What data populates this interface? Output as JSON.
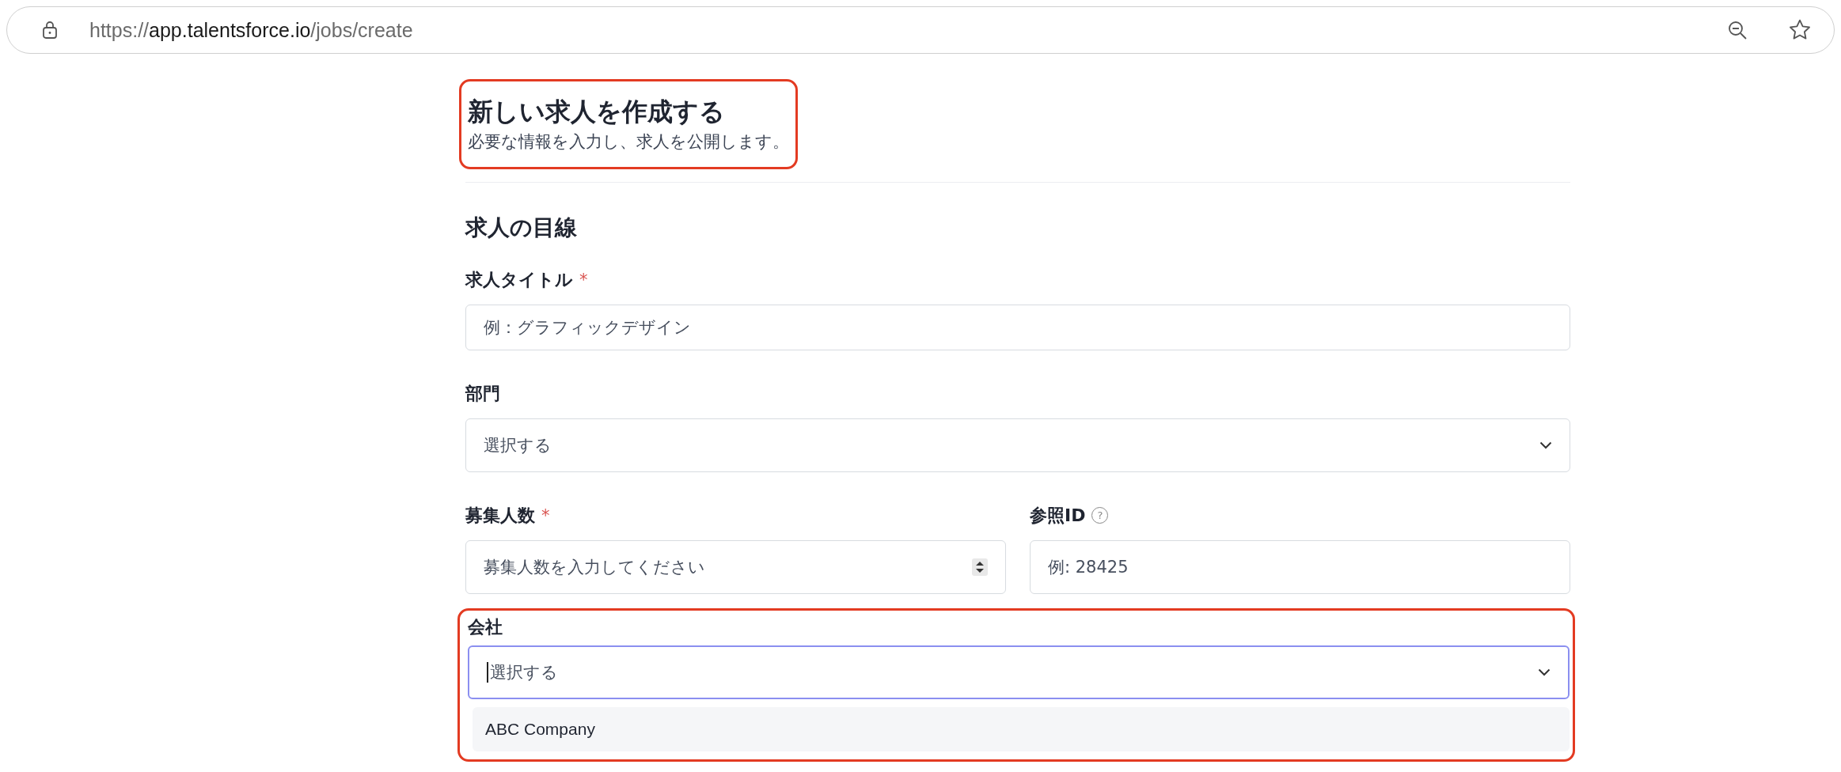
{
  "browser": {
    "url_host_prefix": "https://",
    "url_host": "app.talentsforce.io",
    "url_path": "/jobs/create"
  },
  "header": {
    "title": "新しい求人を作成する",
    "subtitle": "必要な情報を入力し、求人を公開します。",
    "highlighted": true
  },
  "section": {
    "title": "求人の目線"
  },
  "fields": [
    {
      "kind": "text",
      "label": "求人タイトル",
      "required_mark": "*",
      "placeholder": "例：グラフィックデザイン"
    },
    {
      "kind": "select",
      "label": "部門",
      "placeholder": "選択する"
    }
  ],
  "pair": [
    {
      "kind": "number",
      "label": "募集人数",
      "required_mark": "*",
      "placeholder": "募集人数を入力してください"
    },
    {
      "kind": "text",
      "label": "参照ID",
      "placeholder": "例: 28425",
      "help_icon": "?"
    }
  ],
  "company": {
    "label": "会社",
    "placeholder": "選択する",
    "focused": true,
    "highlighted": true,
    "options": [
      {
        "label": "ABC Company",
        "selected": false
      }
    ]
  }
}
